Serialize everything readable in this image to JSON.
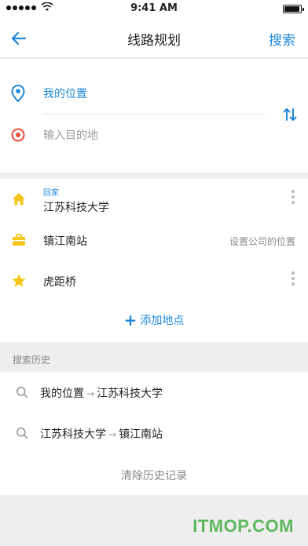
{
  "status_bar": {
    "time": "9:41 AM"
  },
  "nav": {
    "title": "线路规划",
    "search_label": "搜索"
  },
  "route": {
    "origin": "我的位置",
    "destination_placeholder": "输入目的地"
  },
  "places": {
    "home": {
      "tag": "回家",
      "name": "江苏科技大学"
    },
    "work": {
      "name": "镇江南站",
      "hint": "设置公司的位置"
    },
    "favorite": {
      "name": "虎距桥"
    },
    "add_label": "添加地点"
  },
  "history": {
    "header": "搜索历史",
    "items": [
      {
        "from": "我的位置",
        "arrow": "→",
        "to": "江苏科技大学"
      },
      {
        "from": "江苏科技大学",
        "arrow": "→",
        "to": "镇江南站"
      }
    ],
    "clear_label": "清除历史记录"
  },
  "watermark": "ITMOP.COM",
  "colors": {
    "accent": "#1e88d9",
    "home": "#f5c518",
    "work": "#f5c518",
    "favorite": "#f5c518",
    "destination": "#e74c3c"
  }
}
